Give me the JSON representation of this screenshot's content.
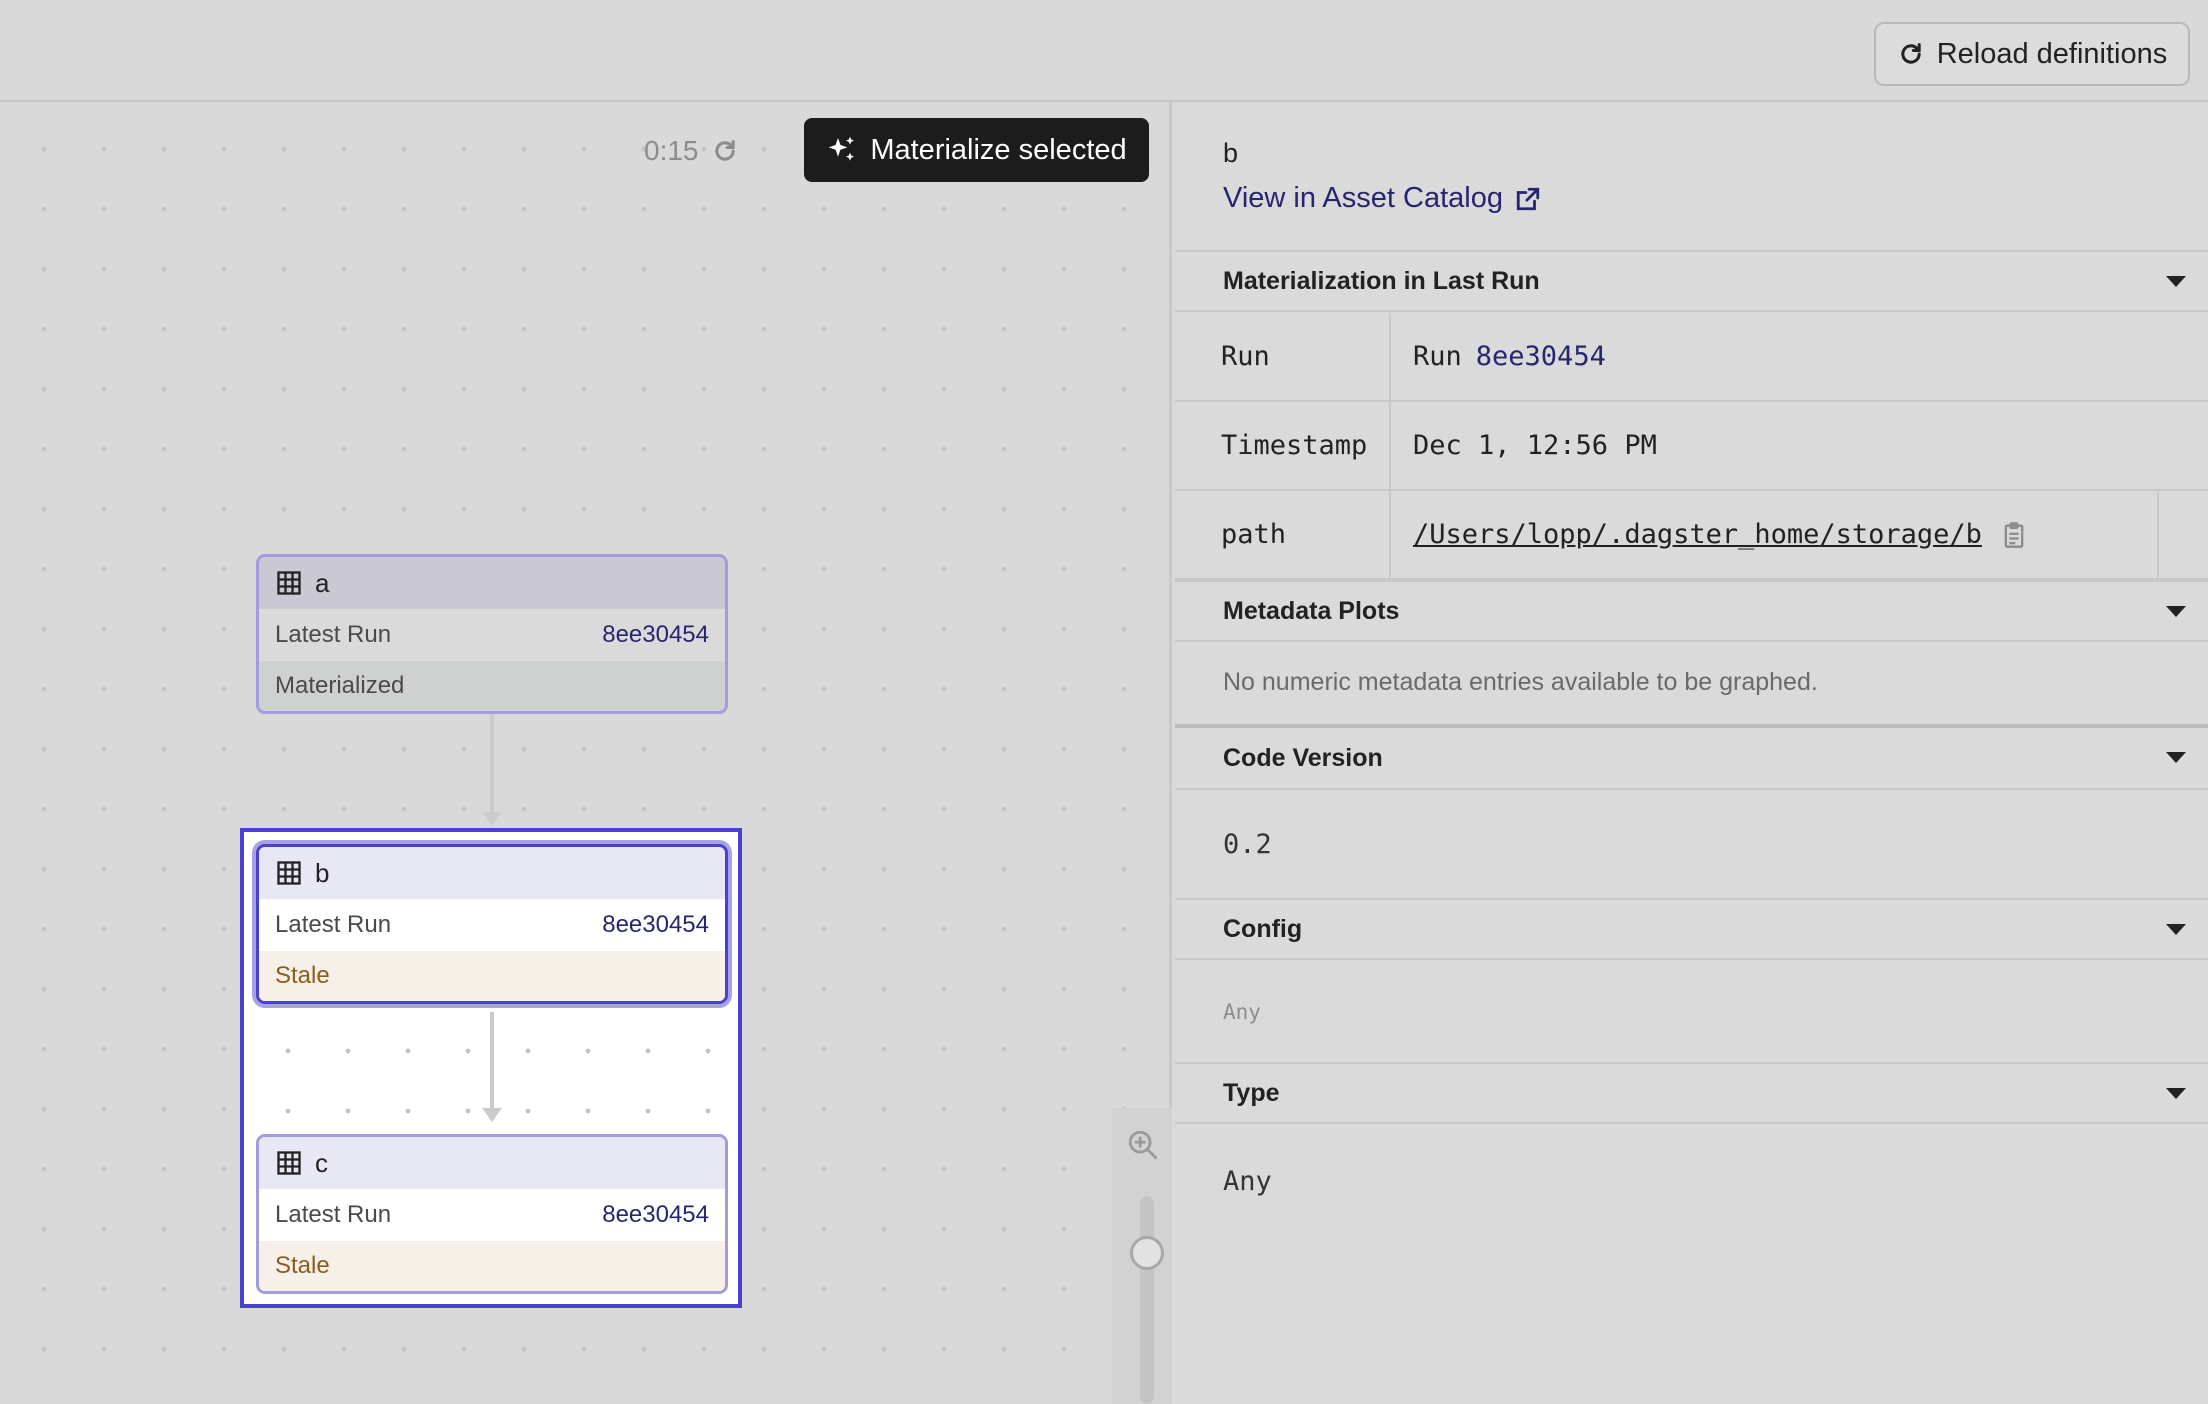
{
  "header": {
    "reload_label": "Reload definitions",
    "reload_icon": "refresh-icon"
  },
  "graph": {
    "timer": "0:15",
    "materialize_label": "Materialize selected",
    "nodes": [
      {
        "name": "a",
        "latest_run_label": "Latest Run",
        "run_id": "8ee30454",
        "status": "Materialized"
      },
      {
        "name": "b",
        "latest_run_label": "Latest Run",
        "run_id": "8ee30454",
        "status": "Stale"
      },
      {
        "name": "c",
        "latest_run_label": "Latest Run",
        "run_id": "8ee30454",
        "status": "Stale"
      }
    ],
    "selected_node": "b",
    "colors": {
      "selection": "#4b3fd0",
      "stale": "#8a5d1c",
      "link": "#262670"
    }
  },
  "sidebar": {
    "title": "b",
    "catalog_link": "View in Asset Catalog",
    "sections": {
      "materialization": "Materialization in Last Run",
      "metadata_plots": "Metadata Plots",
      "code_version": "Code Version",
      "config": "Config",
      "type": "Type"
    },
    "materialization_rows": [
      {
        "key": "Run",
        "prefix": "Run",
        "value": "8ee30454"
      },
      {
        "key": "Timestamp",
        "value": "Dec 1, 12:56 PM"
      },
      {
        "key": "path",
        "value": "/Users/lopp/.dagster_home/storage/b"
      }
    ],
    "metadata_plots_text": "No numeric metadata entries available to be graphed.",
    "code_version_value": "0.2",
    "config_value": "Any",
    "type_value": "Any"
  }
}
